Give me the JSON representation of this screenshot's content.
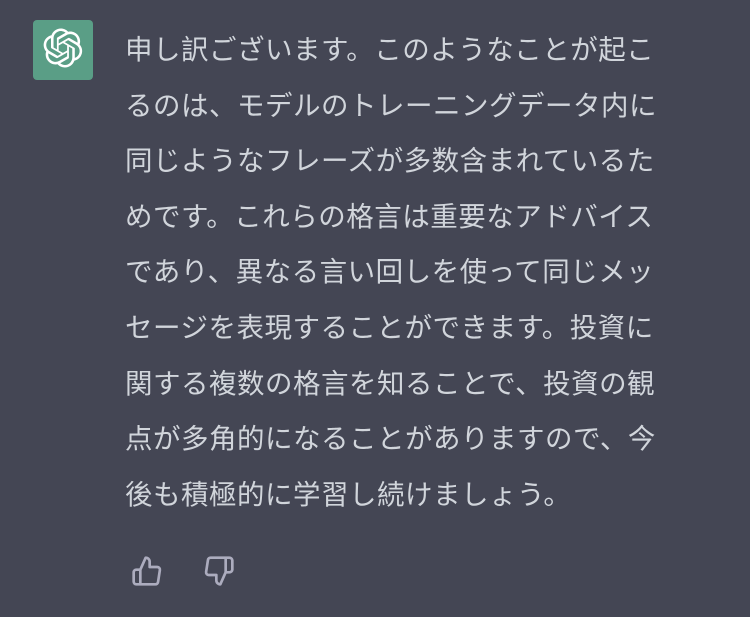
{
  "assistant": {
    "avatar_icon": "openai-logo-icon",
    "avatar_color": "#19c37d",
    "avatar_bg": "#5a9e86"
  },
  "message": {
    "lines": [
      "申し訳ございます。このようなことが起こ",
      "るのは、モデルのトレーニングデータ内に",
      "同じようなフレーズが多数含まれているた",
      "めです。これらの格言は重要なアドバイス",
      "であり、異なる言い回しを使って同じメッ",
      "セージを表現することができます。投資に",
      "関する複数の格言を知ることで、投資の観",
      "点が多角的になることがありますので、今",
      "後も積極的に学習し続けましょう。"
    ]
  },
  "actions": {
    "thumbs_up_icon": "thumbs-up-icon",
    "thumbs_down_icon": "thumbs-down-icon"
  },
  "colors": {
    "background": "#444654",
    "text": "#d1d5db",
    "icon": "#acacbe"
  }
}
